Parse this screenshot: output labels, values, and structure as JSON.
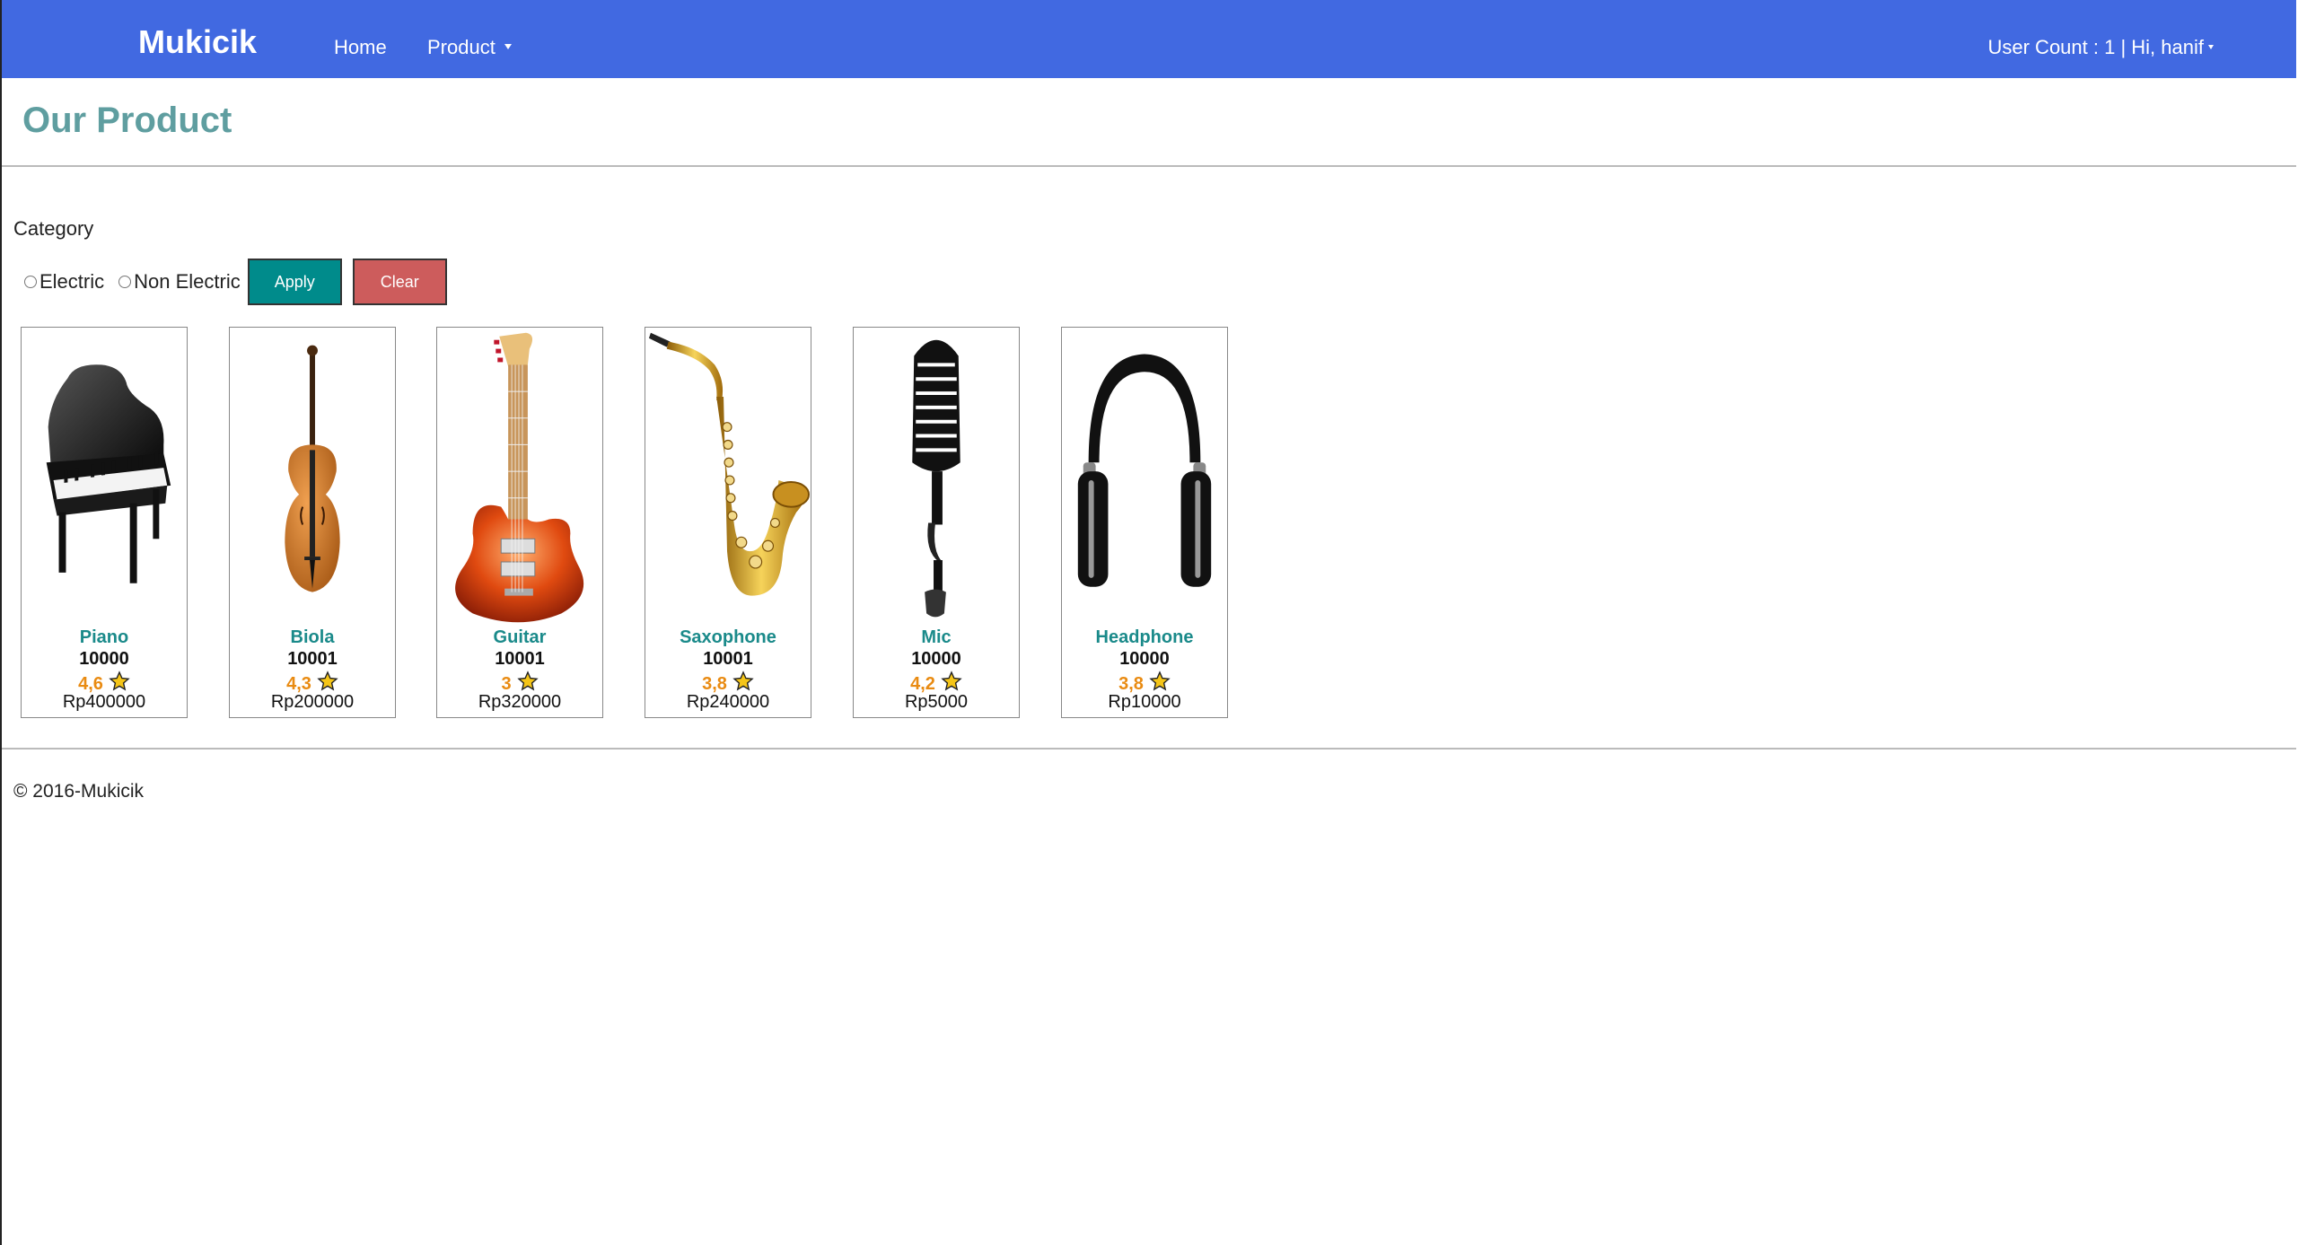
{
  "navbar": {
    "brand": "Mukicik",
    "home": "Home",
    "product": "Product",
    "user_count": "User Count : 1 | ",
    "user_greeting": "Hi, hanif",
    "bg_color": "#4169e1"
  },
  "main": {
    "title": "Our Product",
    "category_label": "Category",
    "filters": {
      "electric_label": "Electric",
      "non_electric_label": "Non Electric",
      "apply_label": "Apply",
      "clear_label": "Clear"
    }
  },
  "products": [
    {
      "name": "Piano",
      "stock": "10000",
      "rating": "4,6",
      "price": "Rp400000",
      "icon": "piano-icon"
    },
    {
      "name": "Biola",
      "stock": "10001",
      "rating": "4,3",
      "price": "Rp200000",
      "icon": "violin-icon"
    },
    {
      "name": "Guitar",
      "stock": "10001",
      "rating": "3",
      "price": "Rp320000",
      "icon": "guitar-icon"
    },
    {
      "name": "Saxophone",
      "stock": "10001",
      "rating": "3,8",
      "price": "Rp240000",
      "icon": "saxophone-icon"
    },
    {
      "name": "Mic",
      "stock": "10000",
      "rating": "4,2",
      "price": "Rp5000",
      "icon": "microphone-icon"
    },
    {
      "name": "Headphone",
      "stock": "10000",
      "rating": "3,8",
      "price": "Rp10000",
      "icon": "headphone-icon"
    }
  ],
  "footer": {
    "copyright": "© 2016-Mukicik"
  }
}
